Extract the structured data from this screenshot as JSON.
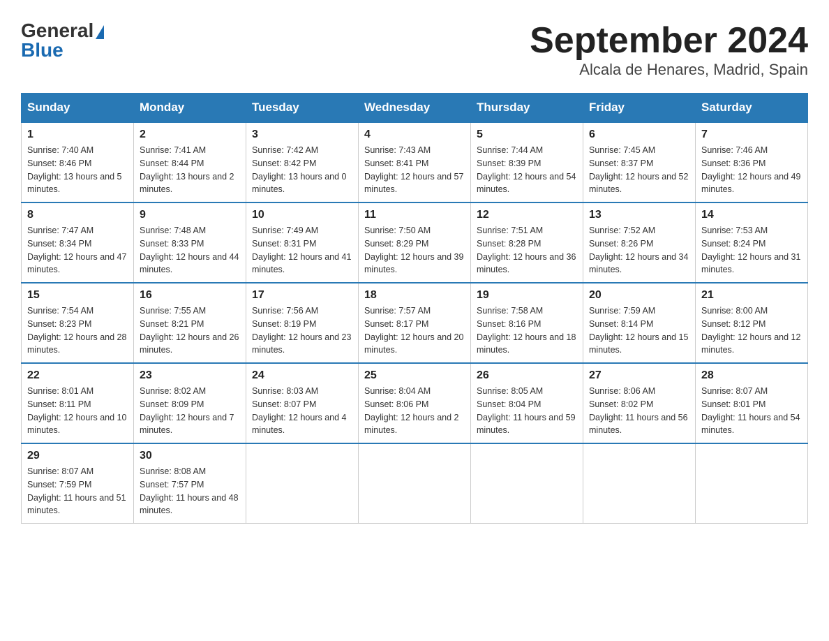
{
  "header": {
    "logo_general": "General",
    "logo_blue": "Blue",
    "month_title": "September 2024",
    "location": "Alcala de Henares, Madrid, Spain"
  },
  "weekdays": [
    "Sunday",
    "Monday",
    "Tuesday",
    "Wednesday",
    "Thursday",
    "Friday",
    "Saturday"
  ],
  "weeks": [
    [
      {
        "day": "1",
        "sunrise": "7:40 AM",
        "sunset": "8:46 PM",
        "daylight": "13 hours and 5 minutes."
      },
      {
        "day": "2",
        "sunrise": "7:41 AM",
        "sunset": "8:44 PM",
        "daylight": "13 hours and 2 minutes."
      },
      {
        "day": "3",
        "sunrise": "7:42 AM",
        "sunset": "8:42 PM",
        "daylight": "13 hours and 0 minutes."
      },
      {
        "day": "4",
        "sunrise": "7:43 AM",
        "sunset": "8:41 PM",
        "daylight": "12 hours and 57 minutes."
      },
      {
        "day": "5",
        "sunrise": "7:44 AM",
        "sunset": "8:39 PM",
        "daylight": "12 hours and 54 minutes."
      },
      {
        "day": "6",
        "sunrise": "7:45 AM",
        "sunset": "8:37 PM",
        "daylight": "12 hours and 52 minutes."
      },
      {
        "day": "7",
        "sunrise": "7:46 AM",
        "sunset": "8:36 PM",
        "daylight": "12 hours and 49 minutes."
      }
    ],
    [
      {
        "day": "8",
        "sunrise": "7:47 AM",
        "sunset": "8:34 PM",
        "daylight": "12 hours and 47 minutes."
      },
      {
        "day": "9",
        "sunrise": "7:48 AM",
        "sunset": "8:33 PM",
        "daylight": "12 hours and 44 minutes."
      },
      {
        "day": "10",
        "sunrise": "7:49 AM",
        "sunset": "8:31 PM",
        "daylight": "12 hours and 41 minutes."
      },
      {
        "day": "11",
        "sunrise": "7:50 AM",
        "sunset": "8:29 PM",
        "daylight": "12 hours and 39 minutes."
      },
      {
        "day": "12",
        "sunrise": "7:51 AM",
        "sunset": "8:28 PM",
        "daylight": "12 hours and 36 minutes."
      },
      {
        "day": "13",
        "sunrise": "7:52 AM",
        "sunset": "8:26 PM",
        "daylight": "12 hours and 34 minutes."
      },
      {
        "day": "14",
        "sunrise": "7:53 AM",
        "sunset": "8:24 PM",
        "daylight": "12 hours and 31 minutes."
      }
    ],
    [
      {
        "day": "15",
        "sunrise": "7:54 AM",
        "sunset": "8:23 PM",
        "daylight": "12 hours and 28 minutes."
      },
      {
        "day": "16",
        "sunrise": "7:55 AM",
        "sunset": "8:21 PM",
        "daylight": "12 hours and 26 minutes."
      },
      {
        "day": "17",
        "sunrise": "7:56 AM",
        "sunset": "8:19 PM",
        "daylight": "12 hours and 23 minutes."
      },
      {
        "day": "18",
        "sunrise": "7:57 AM",
        "sunset": "8:17 PM",
        "daylight": "12 hours and 20 minutes."
      },
      {
        "day": "19",
        "sunrise": "7:58 AM",
        "sunset": "8:16 PM",
        "daylight": "12 hours and 18 minutes."
      },
      {
        "day": "20",
        "sunrise": "7:59 AM",
        "sunset": "8:14 PM",
        "daylight": "12 hours and 15 minutes."
      },
      {
        "day": "21",
        "sunrise": "8:00 AM",
        "sunset": "8:12 PM",
        "daylight": "12 hours and 12 minutes."
      }
    ],
    [
      {
        "day": "22",
        "sunrise": "8:01 AM",
        "sunset": "8:11 PM",
        "daylight": "12 hours and 10 minutes."
      },
      {
        "day": "23",
        "sunrise": "8:02 AM",
        "sunset": "8:09 PM",
        "daylight": "12 hours and 7 minutes."
      },
      {
        "day": "24",
        "sunrise": "8:03 AM",
        "sunset": "8:07 PM",
        "daylight": "12 hours and 4 minutes."
      },
      {
        "day": "25",
        "sunrise": "8:04 AM",
        "sunset": "8:06 PM",
        "daylight": "12 hours and 2 minutes."
      },
      {
        "day": "26",
        "sunrise": "8:05 AM",
        "sunset": "8:04 PM",
        "daylight": "11 hours and 59 minutes."
      },
      {
        "day": "27",
        "sunrise": "8:06 AM",
        "sunset": "8:02 PM",
        "daylight": "11 hours and 56 minutes."
      },
      {
        "day": "28",
        "sunrise": "8:07 AM",
        "sunset": "8:01 PM",
        "daylight": "11 hours and 54 minutes."
      }
    ],
    [
      {
        "day": "29",
        "sunrise": "8:07 AM",
        "sunset": "7:59 PM",
        "daylight": "11 hours and 51 minutes."
      },
      {
        "day": "30",
        "sunrise": "8:08 AM",
        "sunset": "7:57 PM",
        "daylight": "11 hours and 48 minutes."
      },
      null,
      null,
      null,
      null,
      null
    ]
  ]
}
